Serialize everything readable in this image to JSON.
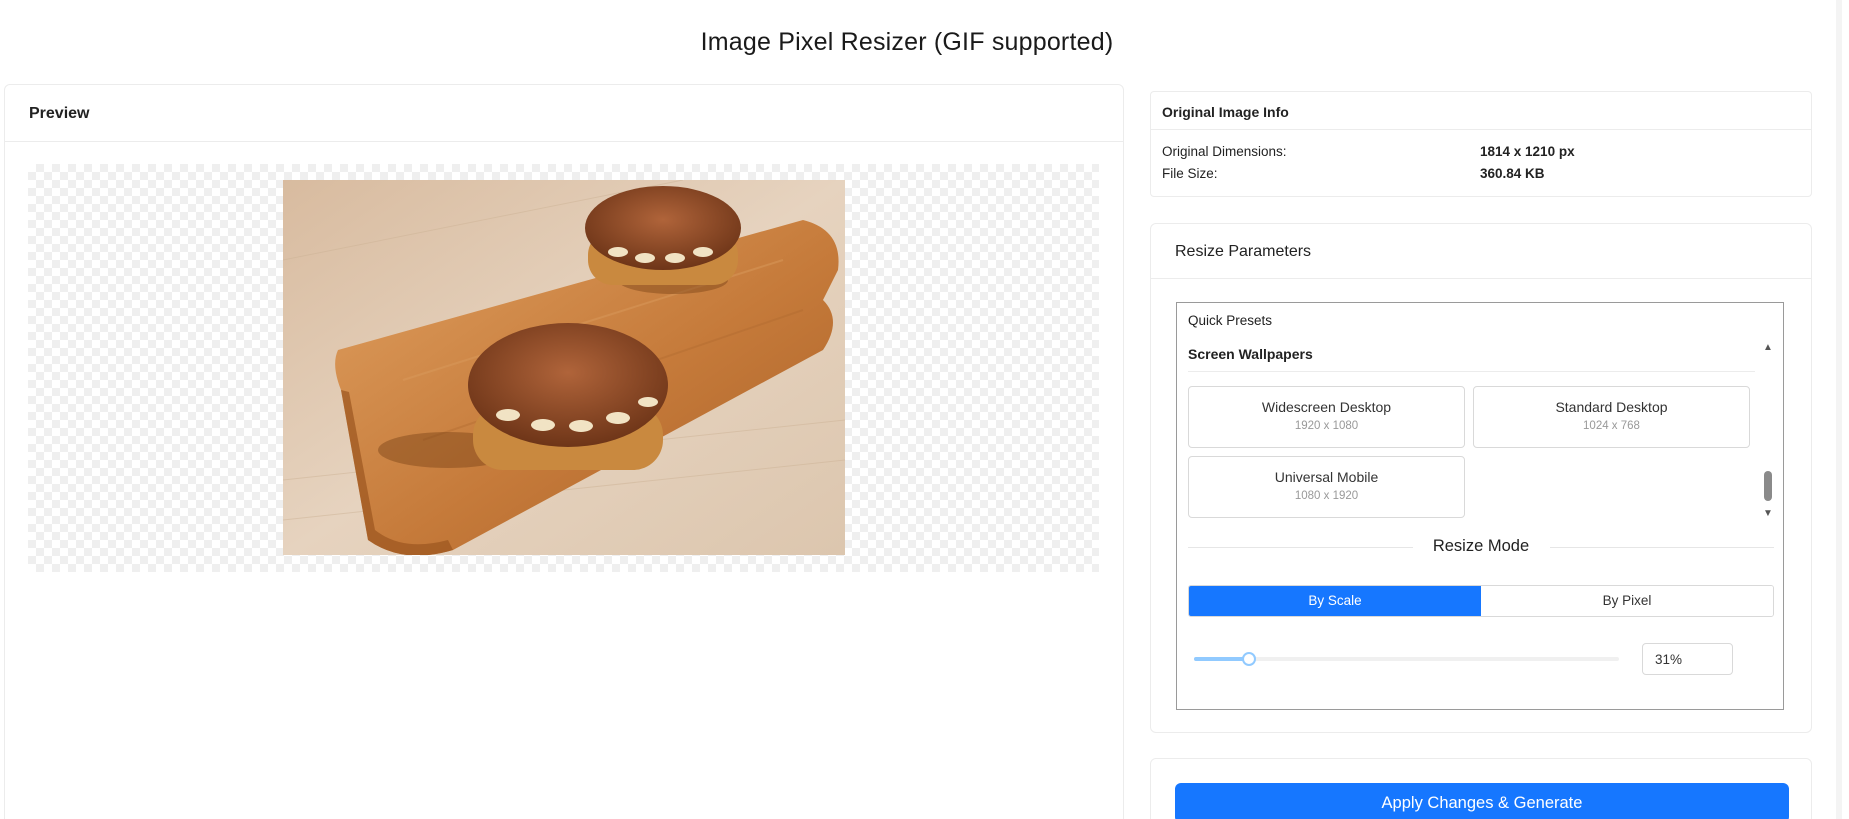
{
  "page": {
    "title": "Image Pixel Resizer (GIF supported)"
  },
  "preview": {
    "title": "Preview",
    "image_name": "tiramisu-cakes-image"
  },
  "original_info": {
    "title": "Original Image Info",
    "dimensions_label": "Original Dimensions:",
    "dimensions_value": "1814 x 1210 px",
    "filesize_label": "File Size:",
    "filesize_value": "360.84 KB"
  },
  "params": {
    "title": "Resize Parameters",
    "presets_label": "Quick Presets",
    "group_title": "Screen Wallpapers",
    "presets": [
      {
        "name": "Widescreen Desktop",
        "dims": "1920 x 1080"
      },
      {
        "name": "Standard Desktop",
        "dims": "1024 x 768"
      },
      {
        "name": "Universal Mobile",
        "dims": "1080 x 1920"
      }
    ],
    "scroll_up_icon": "▲",
    "scroll_down_icon": "▼",
    "mode_title": "Resize Mode",
    "mode_options": [
      "By Scale",
      "By Pixel"
    ],
    "active_mode": "By Scale",
    "scale_value": "31%",
    "scale_fraction": 0.13
  },
  "apply_label": "Apply Changes & Generate",
  "colors": {
    "primary": "#1677ff",
    "slider": "#91caff",
    "border": "#d9d9d9"
  }
}
